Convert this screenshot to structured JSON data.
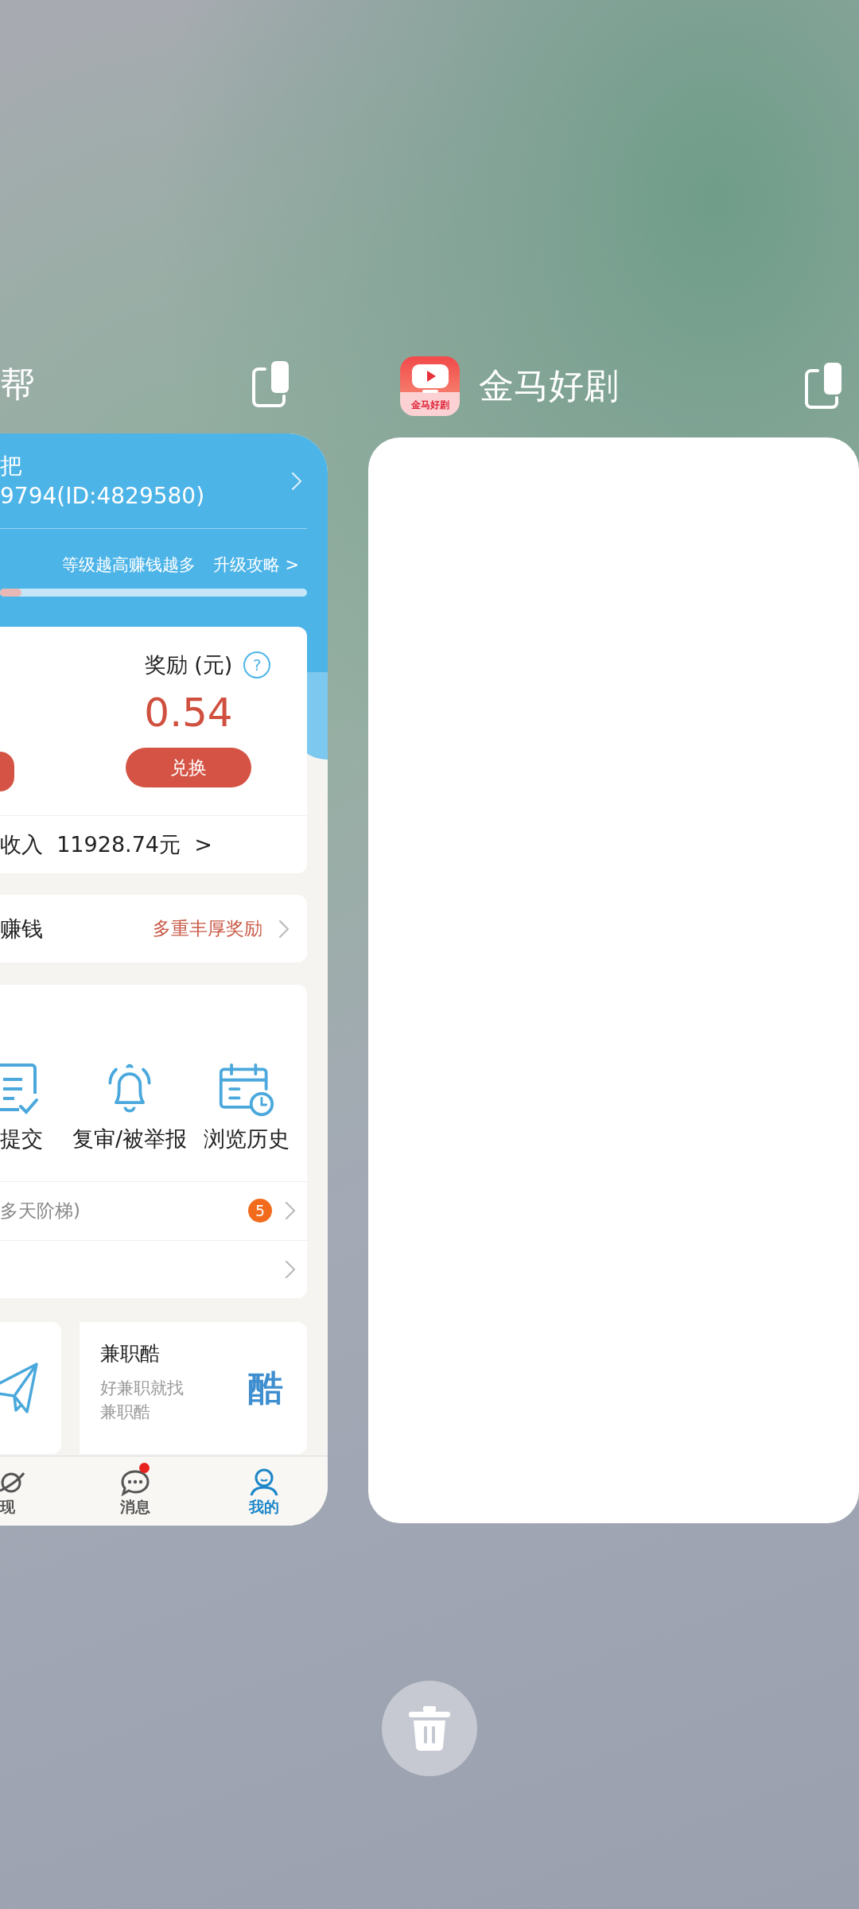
{
  "apps": [
    {
      "kind": "profile_page",
      "title": "帮",
      "screen": {
        "profile": {
          "name": "把",
          "id_line": "9794(ID:4829580)"
        },
        "level": {
          "slogan": "等级越高赚钱越多",
          "guide_link": "升级攻略 >",
          "level": 0.07
        },
        "reward": {
          "label": "奖励 (元)",
          "help": "?",
          "value": "0.54",
          "button": "兑换"
        },
        "income": "收入  11928.74元  >",
        "invite": {
          "label": "赚钱",
          "promo": "多重丰厚奖励"
        },
        "tools": [
          {
            "label": "提交"
          },
          {
            "label": "复审/被举报"
          },
          {
            "label": "浏览历史"
          }
        ],
        "list_rows": [
          {
            "kind": "text",
            "label": "多天阶梯)",
            "badge": "5"
          },
          {
            "kind": "blank"
          }
        ],
        "promos": [
          {
            "kind": "icon"
          },
          {
            "kind": "text",
            "title": "兼职酷",
            "subtitle_lines": [
              "好兼职就找",
              "兼职酷"
            ],
            "logo_text": "酷"
          }
        ],
        "bottom_nav": [
          {
            "label": "现",
            "selected": false,
            "dot": false
          },
          {
            "label": "消息",
            "selected": false,
            "dot": true
          },
          {
            "label": "我的",
            "selected": true,
            "dot": false
          }
        ]
      }
    },
    {
      "kind": "blank",
      "title": "金马好剧",
      "icon_text": "金马好剧"
    }
  ]
}
